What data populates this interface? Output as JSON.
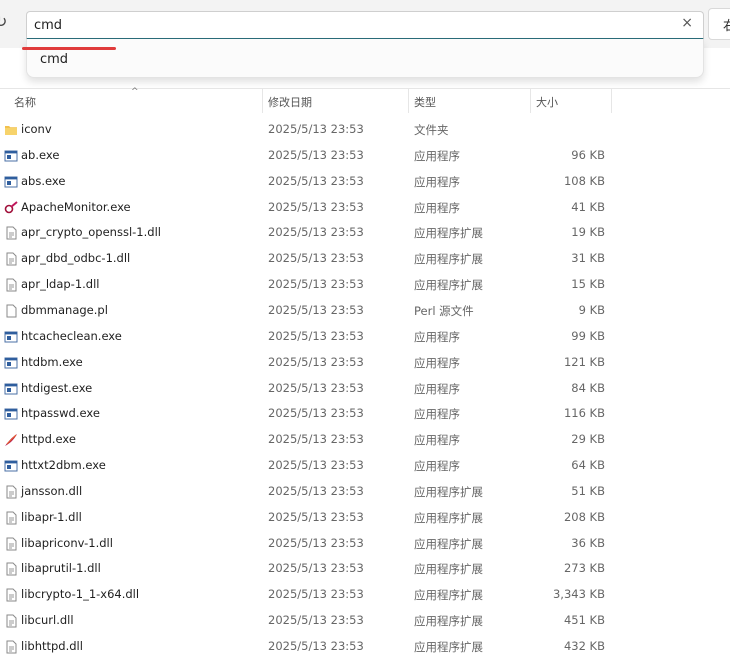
{
  "search": {
    "value": "cmd",
    "clear_label": "×"
  },
  "suggestion": {
    "label": "cmd"
  },
  "right_clip_label": "右",
  "columns": {
    "name": "名称",
    "date": "修改日期",
    "type": "类型",
    "size": "大小"
  },
  "files": [
    {
      "name": "iconv",
      "date": "2025/5/13 23:53",
      "type": "文件夹",
      "size": "",
      "icon": "folder-icon"
    },
    {
      "name": "ab.exe",
      "date": "2025/5/13 23:53",
      "type": "应用程序",
      "size": "96 KB",
      "icon": "exe-icon"
    },
    {
      "name": "abs.exe",
      "date": "2025/5/13 23:53",
      "type": "应用程序",
      "size": "108 KB",
      "icon": "exe-icon"
    },
    {
      "name": "ApacheMonitor.exe",
      "date": "2025/5/13 23:53",
      "type": "应用程序",
      "size": "41 KB",
      "icon": "apache-monitor-icon"
    },
    {
      "name": "apr_crypto_openssl-1.dll",
      "date": "2025/5/13 23:53",
      "type": "应用程序扩展",
      "size": "19 KB",
      "icon": "dll-icon"
    },
    {
      "name": "apr_dbd_odbc-1.dll",
      "date": "2025/5/13 23:53",
      "type": "应用程序扩展",
      "size": "31 KB",
      "icon": "dll-icon"
    },
    {
      "name": "apr_ldap-1.dll",
      "date": "2025/5/13 23:53",
      "type": "应用程序扩展",
      "size": "15 KB",
      "icon": "dll-icon"
    },
    {
      "name": "dbmmanage.pl",
      "date": "2025/5/13 23:53",
      "type": "Perl 源文件",
      "size": "9 KB",
      "icon": "file-icon"
    },
    {
      "name": "htcacheclean.exe",
      "date": "2025/5/13 23:53",
      "type": "应用程序",
      "size": "99 KB",
      "icon": "exe-icon"
    },
    {
      "name": "htdbm.exe",
      "date": "2025/5/13 23:53",
      "type": "应用程序",
      "size": "121 KB",
      "icon": "exe-icon"
    },
    {
      "name": "htdigest.exe",
      "date": "2025/5/13 23:53",
      "type": "应用程序",
      "size": "84 KB",
      "icon": "exe-icon"
    },
    {
      "name": "htpasswd.exe",
      "date": "2025/5/13 23:53",
      "type": "应用程序",
      "size": "116 KB",
      "icon": "exe-icon"
    },
    {
      "name": "httpd.exe",
      "date": "2025/5/13 23:53",
      "type": "应用程序",
      "size": "29 KB",
      "icon": "apache-feather-icon"
    },
    {
      "name": "httxt2dbm.exe",
      "date": "2025/5/13 23:53",
      "type": "应用程序",
      "size": "64 KB",
      "icon": "exe-icon"
    },
    {
      "name": "jansson.dll",
      "date": "2025/5/13 23:53",
      "type": "应用程序扩展",
      "size": "51 KB",
      "icon": "dll-icon"
    },
    {
      "name": "libapr-1.dll",
      "date": "2025/5/13 23:53",
      "type": "应用程序扩展",
      "size": "208 KB",
      "icon": "dll-icon"
    },
    {
      "name": "libapriconv-1.dll",
      "date": "2025/5/13 23:53",
      "type": "应用程序扩展",
      "size": "36 KB",
      "icon": "dll-icon"
    },
    {
      "name": "libaprutil-1.dll",
      "date": "2025/5/13 23:53",
      "type": "应用程序扩展",
      "size": "273 KB",
      "icon": "dll-icon"
    },
    {
      "name": "libcrypto-1_1-x64.dll",
      "date": "2025/5/13 23:53",
      "type": "应用程序扩展",
      "size": "3,343 KB",
      "icon": "dll-icon"
    },
    {
      "name": "libcurl.dll",
      "date": "2025/5/13 23:53",
      "type": "应用程序扩展",
      "size": "451 KB",
      "icon": "dll-icon"
    },
    {
      "name": "libhttpd.dll",
      "date": "2025/5/13 23:53",
      "type": "应用程序扩展",
      "size": "432 KB",
      "icon": "dll-icon"
    }
  ],
  "colors": {
    "accent": "#2a6d7a",
    "annotation": "#e03b3b",
    "folder": "#f2c14e"
  }
}
